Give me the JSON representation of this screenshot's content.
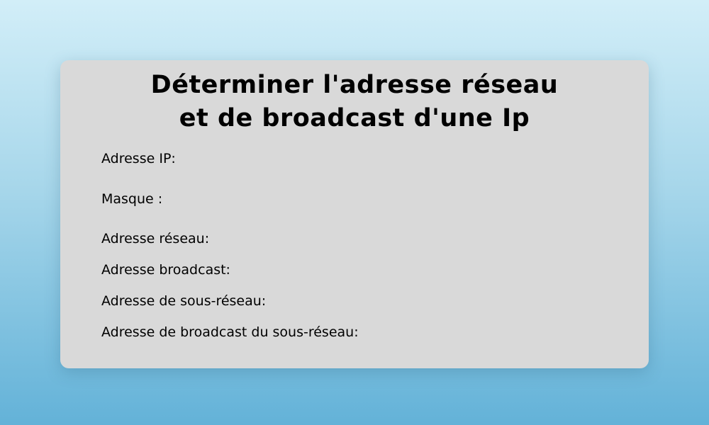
{
  "colors": {
    "background_top": "#d2eef8",
    "background_bottom": "#63b2d8",
    "card": "#d9d9d9",
    "text": "#000000"
  },
  "card": {
    "title_line1": "Déterminer l'adresse réseau",
    "title_line2": "et de broadcast d'une Ip",
    "fields": {
      "ip_label": "Adresse IP:",
      "ip_value": "",
      "mask_label": "Masque :",
      "mask_value": "",
      "network_label": "Adresse réseau:",
      "network_value": "",
      "broadcast_label": "Adresse broadcast:",
      "broadcast_value": "",
      "subnet_label": "Adresse de sous-réseau:",
      "subnet_value": "",
      "subnet_broadcast_label": "Adresse de broadcast du sous-réseau:",
      "subnet_broadcast_value": ""
    }
  }
}
